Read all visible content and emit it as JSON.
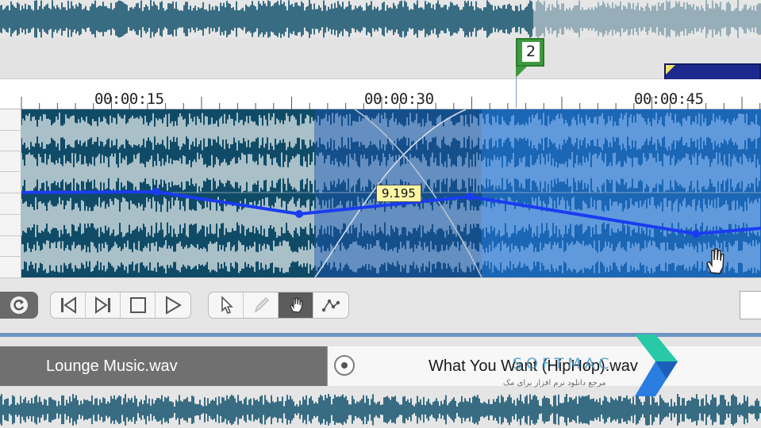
{
  "marker": {
    "label": "2"
  },
  "ruler": {
    "labels": [
      "00:00:15",
      "00:00:30",
      "00:00:45"
    ]
  },
  "envelope": {
    "value_tag": "9.195"
  },
  "toolbar": {
    "buttons": [
      {
        "name": "rewind-to-start-button",
        "icon": "skip-start-icon"
      },
      {
        "name": "go-to-end-button",
        "icon": "skip-end-icon"
      },
      {
        "name": "stop-button",
        "icon": "stop-icon"
      },
      {
        "name": "play-button",
        "icon": "play-icon"
      },
      {
        "name": "arrow-tool-button",
        "icon": "arrow-cursor-icon"
      },
      {
        "name": "pencil-tool-button",
        "icon": "pencil-icon"
      },
      {
        "name": "hand-tool-button",
        "icon": "hand-icon",
        "active": true
      },
      {
        "name": "envelope-tool-button",
        "icon": "envelope-points-icon"
      }
    ]
  },
  "clips": {
    "left": {
      "title": "Lounge Music.wav"
    },
    "right": {
      "title": "What You Want (HipHop).wav"
    }
  },
  "watermark": {
    "brand": "SOFTMAC",
    "tagline": "مرجع دانلود نرم افزار برای مک"
  },
  "colors": {
    "waveform_dark": "#0d4d6a",
    "waveform_selected": "#1565c0",
    "selection_light": "#86b6f2",
    "envelope": "#1a3cf0",
    "marker_green": "#3f9a3f",
    "region_blue": "#1b2a8c"
  }
}
